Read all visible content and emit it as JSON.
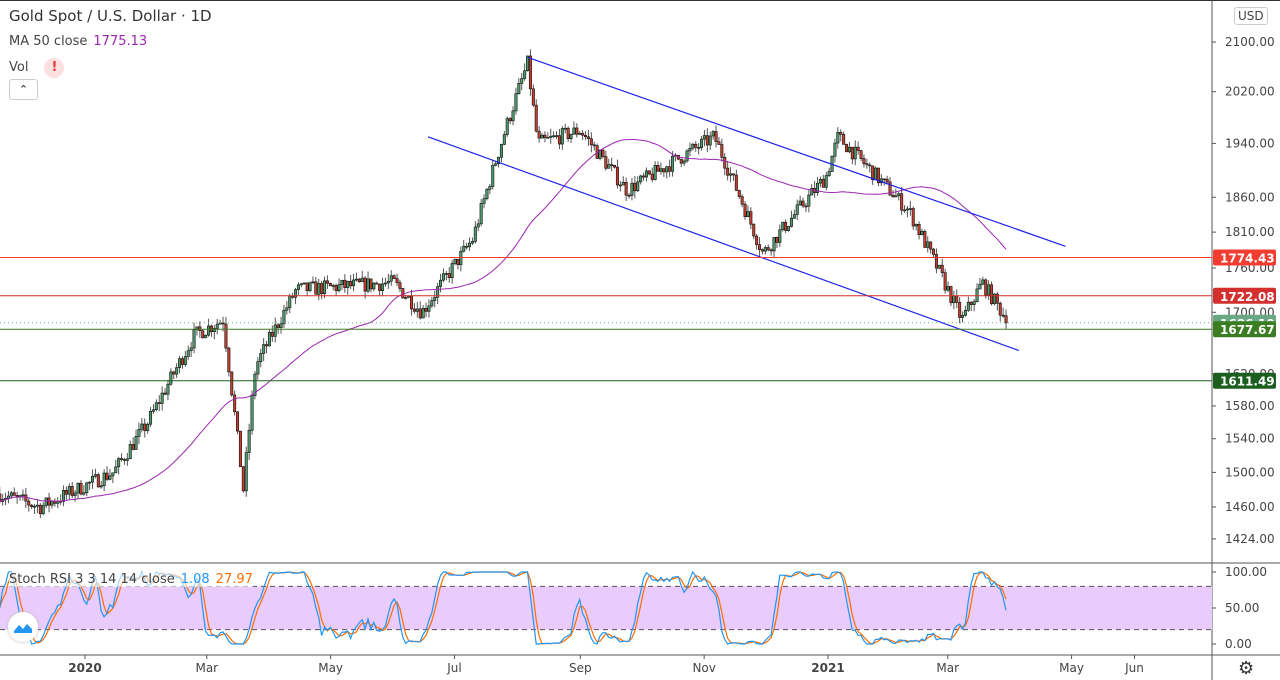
{
  "header": {
    "title": "Gold Spot / U.S. Dollar · 1D",
    "ma_label": "MA 50 close",
    "ma_value": "1775.13",
    "vol_label": "Vol",
    "warn_icon": "!",
    "collapse_icon": "⌃"
  },
  "currency": "USD",
  "stoch": {
    "label": "Stoch RSI 3 3 14 14 close",
    "k": "1.08",
    "d": "27.97"
  },
  "colors": {
    "up": "#4c9a6c",
    "down": "#c43d2e",
    "ma": "#9c27b0",
    "channel": "#1e22e6",
    "k": "#2196f3",
    "d": "#ff6d00",
    "band": "#e9ccfc"
  },
  "chart_data": {
    "type": "candlestick",
    "title": "Gold Spot / U.S. Dollar · 1D",
    "price_axis_ticks": [
      "2100.00",
      "2020.00",
      "1940.00",
      "1860.00",
      "1810.00",
      "1760.00",
      "1700.00",
      "1620.00",
      "1580.00",
      "1540.00",
      "1500.00",
      "1460.00",
      "1424.00"
    ],
    "time_axis_ticks": [
      "2020",
      "Mar",
      "May",
      "Jul",
      "Sep",
      "Nov",
      "2021",
      "Mar",
      "May",
      "Jun"
    ],
    "stoch_axis_ticks": [
      "100.00",
      "50.00",
      "0.00"
    ],
    "approx_close_path": [
      [
        "2019-11-20",
        1475
      ],
      [
        "2019-12-10",
        1460
      ],
      [
        "2020-01-15",
        1500
      ],
      [
        "2020-02-01",
        1560
      ],
      [
        "2020-02-24",
        1670
      ],
      [
        "2020-03-09",
        1690
      ],
      [
        "2020-03-19",
        1480
      ],
      [
        "2020-03-25",
        1630
      ],
      [
        "2020-04-14",
        1730
      ],
      [
        "2020-06-01",
        1740
      ],
      [
        "2020-06-15",
        1700
      ],
      [
        "2020-07-10",
        1800
      ],
      [
        "2020-07-27",
        1970
      ],
      [
        "2020-08-06",
        2065
      ],
      [
        "2020-08-11",
        1940
      ],
      [
        "2020-09-01",
        1960
      ],
      [
        "2020-09-24",
        1870
      ],
      [
        "2020-11-06",
        1950
      ],
      [
        "2020-11-30",
        1780
      ],
      [
        "2020-12-31",
        1890
      ],
      [
        "2021-01-06",
        1950
      ],
      [
        "2021-02-10",
        1840
      ],
      [
        "2021-03-08",
        1690
      ],
      [
        "2021-03-18",
        1740
      ],
      [
        "2021-03-31",
        1686
      ]
    ],
    "horizontal_levels": [
      {
        "value": "1774.43",
        "color": "#f23c2f"
      },
      {
        "value": "1722.08",
        "color": "#d32f2f"
      },
      {
        "value": "1686.10",
        "color": "#6aa884"
      },
      {
        "value": "1677.67",
        "color": "#3a7d22"
      },
      {
        "value": "1611.49",
        "color": "#1b5e20"
      }
    ],
    "channel": {
      "upper": [
        [
          "2020-08-06",
          2075
        ],
        [
          "2021-04-28",
          1790
        ]
      ],
      "lower": [
        [
          "2020-06-18",
          1950
        ],
        [
          "2021-04-05",
          1650
        ]
      ]
    },
    "stoch_levels": [
      80,
      20
    ]
  }
}
